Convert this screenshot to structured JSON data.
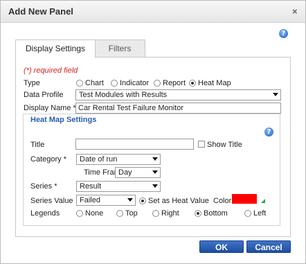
{
  "dialog": {
    "title": "Add New Panel",
    "close_glyph": "×",
    "help_glyph": "?"
  },
  "tabs": [
    {
      "label": "Display Settings",
      "active": true
    },
    {
      "label": "Filters",
      "active": false
    }
  ],
  "form": {
    "required_note": "(*) required field",
    "type": {
      "label": "Type",
      "options": [
        "Chart",
        "Indicator",
        "Report",
        "Heat Map"
      ],
      "selected": "Heat Map"
    },
    "data_profile": {
      "label": "Data Profile",
      "value": "Test Modules with Results"
    },
    "display_name": {
      "label": "Display Name *",
      "value": "Car Rental Test Failure Monitor"
    }
  },
  "heat_map_settings": {
    "legend": "Heat Map Settings",
    "title_label": "Title",
    "title_value": "",
    "show_title_label": "Show Title",
    "show_title_checked": false,
    "category_label": "Category *",
    "category_value": "Date of run",
    "time_frame_label": "Time Frame",
    "time_frame_value": "Day",
    "series_label": "Series *",
    "series_value": "Result",
    "series_value_label": "Series Value",
    "series_value_value": "Failed",
    "set_as_heat_value_label": "Set as Heat Value",
    "set_as_heat_value_selected": true,
    "color_label": "Color",
    "color_hex": "#ff0000",
    "legends_label": "Legends",
    "legend_options": [
      "None",
      "Top",
      "Right",
      "Bottom",
      "Left"
    ],
    "legend_selected": "Bottom"
  },
  "buttons": {
    "ok": "OK",
    "cancel": "Cancel"
  },
  "colors": {
    "accent": "#2a5bb0",
    "button": "#1f4ea0",
    "required": "#dd2222",
    "indicator": "#2aa34a"
  }
}
